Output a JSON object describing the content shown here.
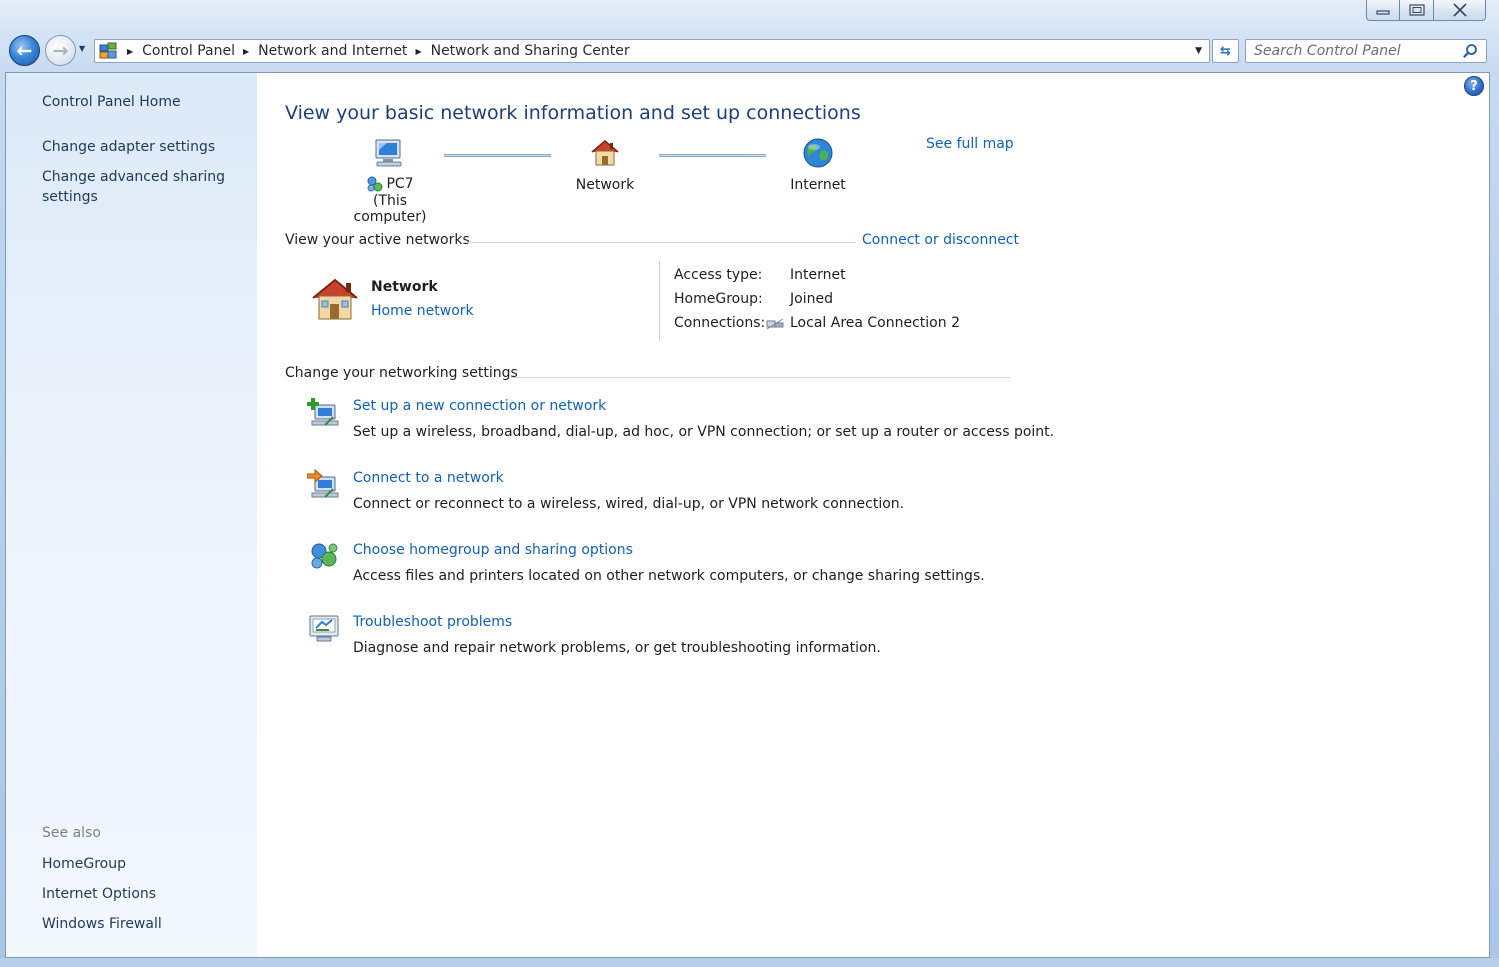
{
  "window": {
    "caption_buttons": {
      "minimize": "▭",
      "maximize": "□",
      "close": "✕"
    }
  },
  "navigation": {
    "back_glyph": "←",
    "forward_glyph": "→",
    "breadcrumb": [
      "Control Panel",
      "Network and Internet",
      "Network and Sharing Center"
    ],
    "refresh_glyph": "⇆",
    "search_placeholder": "Search Control Panel"
  },
  "sidebar": {
    "home": "Control Panel Home",
    "links": [
      "Change adapter settings",
      "Change advanced sharing settings"
    ],
    "see_also_title": "See also",
    "see_also": [
      "HomeGroup",
      "Internet Options",
      "Windows Firewall"
    ]
  },
  "help_glyph": "?",
  "main": {
    "title": "View your basic network information and set up connections",
    "see_full_map": "See full map",
    "map": {
      "computer_name": "PC7",
      "computer_sub": "(This computer)",
      "network": "Network",
      "internet": "Internet"
    },
    "active_networks": {
      "heading": "View your active networks",
      "connect_link": "Connect or disconnect",
      "network_name": "Network",
      "network_type": "Home network",
      "access_type_label": "Access type:",
      "access_type_value": "Internet",
      "homegroup_label": "HomeGroup:",
      "homegroup_value": "Joined",
      "connections_label": "Connections:",
      "connections_value": "Local Area Connection 2"
    },
    "settings": {
      "heading": "Change your networking settings",
      "tasks": [
        {
          "title": "Set up a new connection or network",
          "desc": "Set up a wireless, broadband, dial-up, ad hoc, or VPN connection; or set up a router or access point.",
          "icon": "new-connection-icon"
        },
        {
          "title": "Connect to a network",
          "desc": "Connect or reconnect to a wireless, wired, dial-up, or VPN network connection.",
          "icon": "connect-network-icon"
        },
        {
          "title": "Choose homegroup and sharing options",
          "desc": "Access files and printers located on other network computers, or change sharing settings.",
          "icon": "homegroup-icon"
        },
        {
          "title": "Troubleshoot problems",
          "desc": "Diagnose and repair network problems, or get troubleshooting information.",
          "icon": "troubleshoot-icon"
        }
      ]
    }
  },
  "colors": {
    "link": "#0f62b8",
    "title": "#1e3f7a",
    "sidebar_text": "#1e395b"
  }
}
